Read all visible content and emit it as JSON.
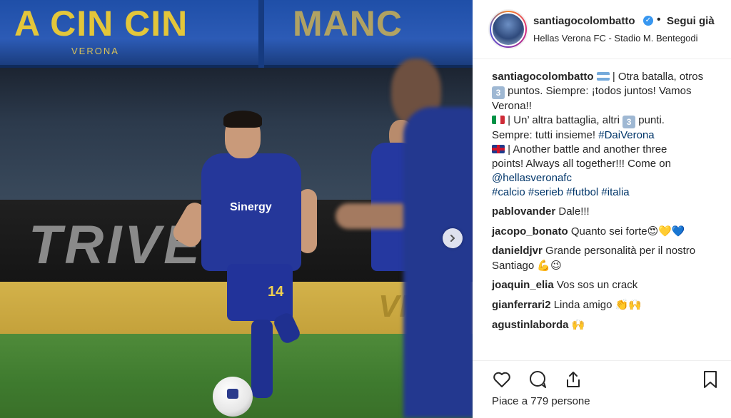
{
  "post": {
    "username": "santiagocolombatto",
    "follow_label": "Segui già",
    "location": "Hellas Verona FC - Stadio M. Bentegodi",
    "dot": "•",
    "verified_mark": "✓"
  },
  "photo": {
    "banner_left": "A CIN CIN",
    "banner_right": "MANC",
    "banner_sub": "VERONA",
    "board_text": "TRIVELL",
    "board_yellow_text": "VIAG",
    "shirt_sponsor": "Sinergy",
    "shirt_number": "14",
    "carousel_next_icon": "chevron-right-icon"
  },
  "caption": {
    "username": "santiagocolombatto",
    "es_1": " | Otra batalla, otros",
    "num3": "3",
    "es_2": " puntos. Siempre: ¡todos juntos! Vamos",
    "es_3": "Verona!!",
    "it_1": " | Un’ altra battaglia, altri ",
    "it_2": " punti.",
    "it_3": "Sempre: tutti insieme! ",
    "it_hashtag": "#DaiVerona",
    "en_1": " | Another battle and another three",
    "en_2": "points! Always all together!!! Come on",
    "mention": "@hellasveronafc",
    "hashtags": "#calcio #serieb #futbol #italia"
  },
  "comments": [
    {
      "user": "pablovander",
      "text": "Dale!!!"
    },
    {
      "user": "jacopo_bonato",
      "text": "Quanto sei forte",
      "emoji": "😍💛💙"
    },
    {
      "user": "danieldjvr",
      "text": "Grande personalità per il nostro",
      "text2": "Santiago ",
      "emoji": "💪😉"
    },
    {
      "user": "joaquin_elia",
      "text": "Vos sos un crack"
    },
    {
      "user": "gianferrari2",
      "text": "Linda amigo ",
      "emoji": "👏🙌"
    },
    {
      "user": "agustinlaborda",
      "text": "",
      "emoji": "🙌"
    }
  ],
  "actions": {
    "icons": [
      "heart-icon",
      "comment-icon",
      "share-icon",
      "bookmark-icon"
    ]
  },
  "likes_text": "Piace a 779 persone",
  "colors": {
    "link": "#003569",
    "verified": "#3897f0",
    "team_blue": "#25379a",
    "team_yellow": "#e3c63a"
  }
}
